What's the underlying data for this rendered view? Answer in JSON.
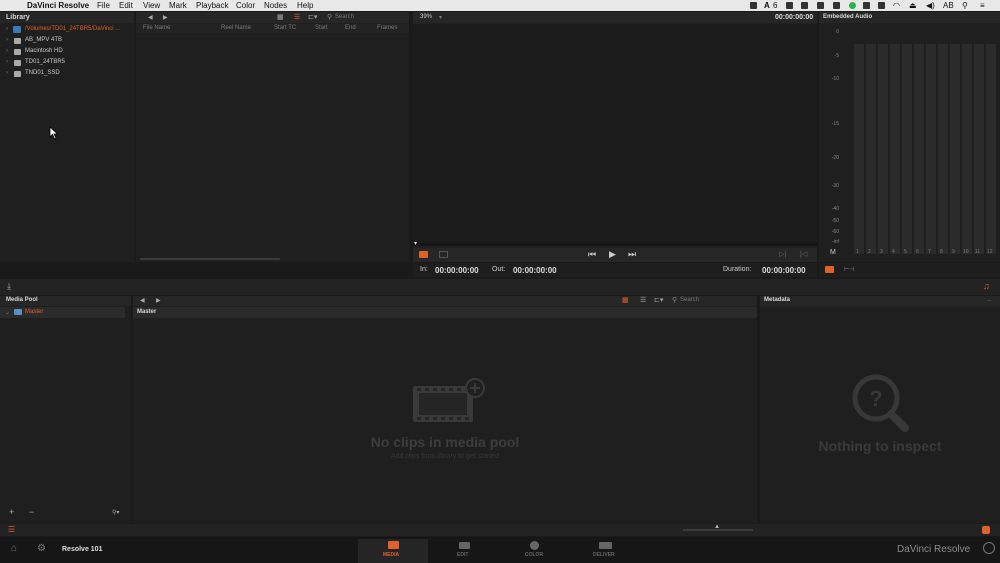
{
  "menubar": {
    "app_name": "DaVinci Resolve",
    "items": [
      "File",
      "Edit",
      "View",
      "Mark",
      "Playback",
      "Color",
      "Nodes",
      "Help"
    ],
    "status_user": "AB",
    "status_a6": "6"
  },
  "library": {
    "title": "Library",
    "items": [
      "/Volumes/TD01_24TBR5/DaVinci ...",
      "AB_MPV 4TB",
      "Macintosh HD",
      "TD01_24TBR5",
      "TND01_SSD"
    ],
    "search_placeholder": "Search",
    "columns": [
      "File Name",
      "Reel Name",
      "Start TC",
      "Start",
      "End",
      "Frames"
    ]
  },
  "viewer": {
    "zoom": "39%",
    "timecode": "00:00:00:00",
    "in_label": "In:",
    "in_value": "00:00:00:00",
    "out_label": "Out:",
    "out_value": "00:00:00:00",
    "duration_label": "Duration:",
    "duration_value": "00:00:00:00"
  },
  "audio": {
    "title": "Embedded Audio",
    "scale": [
      "0",
      "-5",
      "-10",
      "-15",
      "-20",
      "-30",
      "-40",
      "-50",
      "-60",
      "-inf"
    ],
    "m_label": "M",
    "channels": [
      "1",
      "2",
      "3",
      "4",
      "5",
      "6",
      "7",
      "8",
      "9",
      "10",
      "11",
      "12"
    ]
  },
  "media_pool": {
    "title": "Media Pool",
    "bin": "Master",
    "content_title": "Master",
    "search_placeholder": "Search",
    "empty_title": "No clips in media pool",
    "empty_subtitle": "Add clips from library to get started"
  },
  "metadata": {
    "title": "Metadata",
    "empty_title": "Nothing to inspect"
  },
  "bottom": {
    "project_name": "Resolve 101",
    "tabs": [
      "MEDIA",
      "EDIT",
      "COLOR",
      "DELIVER"
    ],
    "brand": "DaVinci Resolve"
  },
  "colors": {
    "accent": "#e0622a",
    "panel": "#1f1f1f"
  }
}
